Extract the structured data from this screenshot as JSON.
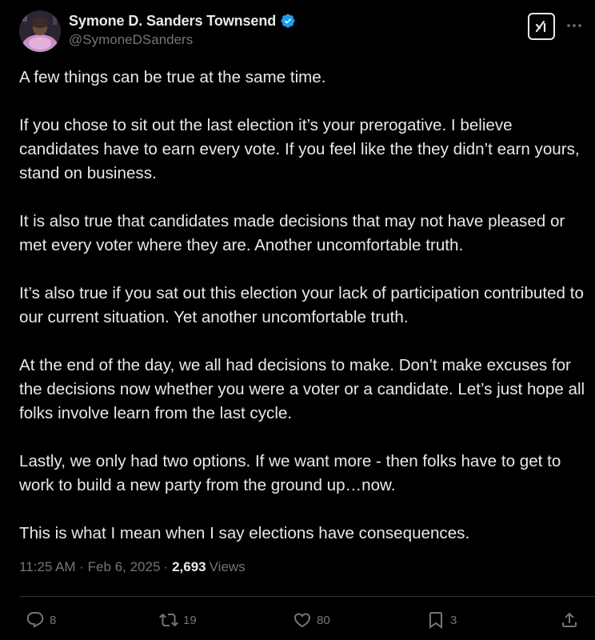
{
  "author": {
    "display_name": "Symone D. Sanders Townsend",
    "handle": "@SymoneDSanders",
    "verified": true,
    "avatar_icon": "avatar-photo"
  },
  "header": {
    "grok_icon": "grok-icon",
    "more_icon": "more-options-icon"
  },
  "tweet": {
    "paragraphs": [
      "A few things can be true at the same time.",
      "If you chose to sit out the last election it’s your prerogative. I believe candidates have to earn every vote. If you feel like the they didn’t earn yours, stand on business.",
      "It is also true that candidates made decisions that may not have pleased or met every voter where they are. Another uncomfortable truth.",
      "It’s also true if you sat out this election your lack of participation contributed to our current situation. Yet another uncomfortable truth.",
      "At the end of the day, we all had decisions to make. Don’t make excuses for the decisions now whether you were a voter or a candidate. Let’s just hope all folks involve learn from the last cycle.",
      "Lastly, we only had two options. If we want more - then folks have to get to work to build a new party from the ground up…now.",
      "This is what I mean when I say elections have consequences."
    ],
    "timestamp": "11:25 AM · Feb 6, 2025",
    "separator": "·",
    "views_count": "2,693",
    "views_label": "Views"
  },
  "actions": {
    "replies": "8",
    "reposts": "19",
    "likes": "80",
    "bookmarks": "3"
  },
  "colors": {
    "background": "#000000",
    "text": "#e7e9ea",
    "muted": "#71767b",
    "verified_blue": "#1d9bf0",
    "divider": "#2f3336"
  }
}
